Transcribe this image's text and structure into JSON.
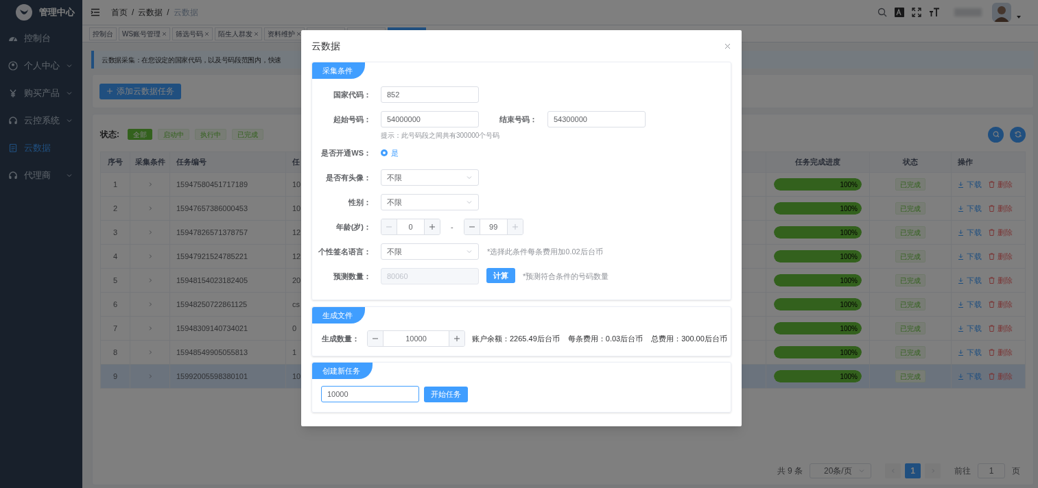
{
  "sidebar": {
    "title": "管理中心",
    "items": [
      {
        "label": "控制台",
        "kind": "dashboard",
        "has_children": false,
        "selected": false
      },
      {
        "label": "个人中心",
        "kind": "user",
        "has_children": true,
        "selected": false
      },
      {
        "label": "购买产品",
        "kind": "yen",
        "has_children": true,
        "selected": false
      },
      {
        "label": "云控系统",
        "kind": "cloud",
        "has_children": true,
        "selected": false
      },
      {
        "label": "云数据",
        "kind": "doc",
        "has_children": false,
        "selected": true
      },
      {
        "label": "代理商",
        "kind": "cloud",
        "has_children": true,
        "selected": false
      }
    ]
  },
  "header": {
    "breadcrumb": [
      {
        "label": "首页"
      },
      {
        "label": "云数据"
      },
      {
        "label": "云数据"
      }
    ],
    "separator": "/"
  },
  "tags": [
    {
      "label": "控制台",
      "closable": false,
      "selected": false
    },
    {
      "label": "WS账号管理",
      "closable": true,
      "selected": false
    },
    {
      "label": "筛选号码",
      "closable": true,
      "selected": false
    },
    {
      "label": "陌生人群发",
      "closable": true,
      "selected": false
    },
    {
      "label": "资料维护",
      "closable": true,
      "selected": false
    },
    {
      "selected": false
    },
    {
      "selected": false
    },
    {
      "selected": true
    }
  ],
  "alert": {
    "text": "云数据采集：在您设定的国家代码，以及号码段范围内，快速"
  },
  "add_button": "添加云数据任务",
  "filter": {
    "label": "状态:",
    "options": [
      {
        "label": "全部",
        "selected": true
      },
      {
        "label": "启动中",
        "selected": false
      },
      {
        "label": "执行中",
        "selected": false
      },
      {
        "label": "已完成",
        "selected": false
      }
    ]
  },
  "table": {
    "columns": [
      "序号",
      "采集条件",
      "任务编号",
      "任",
      "任务完成进度",
      "状态",
      "操作"
    ],
    "rows": [
      {
        "index": "1",
        "task_id": "15947580451717189",
        "column_4": "10",
        "level": 1,
        "progress": "100%",
        "status": "已完成",
        "download": "下载",
        "delete": "删除",
        "selected": false
      },
      {
        "index": "2",
        "task_id": "15947657386000453",
        "column_4": "10",
        "level": 1,
        "progress": "100%",
        "status": "已完成",
        "download": "下载",
        "delete": "删除",
        "selected": false
      },
      {
        "index": "3",
        "task_id": "15947826571378757",
        "column_4": "12",
        "level": 1,
        "progress": "100%",
        "status": "已完成",
        "download": "下载",
        "delete": "删除",
        "selected": false
      },
      {
        "index": "4",
        "task_id": "15947921524785221",
        "column_4": "12",
        "level": 1,
        "progress": "100%",
        "status": "已完成",
        "download": "下载",
        "delete": "删除",
        "selected": false
      },
      {
        "index": "5",
        "task_id": "15948154023182405",
        "column_4": "20",
        "level": 1,
        "progress": "100%",
        "status": "已完成",
        "download": "下载",
        "delete": "删除",
        "selected": false
      },
      {
        "index": "6",
        "task_id": "15948250722861125",
        "column_4": "cs",
        "level": 1,
        "progress": "100%",
        "status": "已完成",
        "download": "下载",
        "delete": "删除",
        "selected": false
      },
      {
        "index": "7",
        "task_id": "15948309140734021",
        "column_4": "0",
        "level": 1,
        "progress": "100%",
        "status": "已完成",
        "download": "下载",
        "delete": "删除",
        "selected": false
      },
      {
        "index": "8",
        "task_id": "15948549905055813",
        "column_4": "1",
        "level": 1,
        "progress": "100%",
        "status": "已完成",
        "download": "下载",
        "delete": "删除",
        "selected": false
      },
      {
        "index": "9",
        "task_id": "15992005598380101",
        "column_4": "10",
        "level": 1,
        "progress": "100%",
        "status": "已完成",
        "download": "下载",
        "delete": "删除",
        "selected": true
      }
    ]
  },
  "pagination": {
    "total": "共 9 条",
    "page_size": "20条/页",
    "pages": [
      {
        "label": "1",
        "selected": true
      }
    ],
    "goto_label": "前往",
    "goto_value": "1",
    "page_suffix": "页"
  },
  "modal": {
    "title": "云数据",
    "criteria": {
      "title": "采集条件",
      "fields": [
        {
          "kind": "input",
          "label": "国家代码：",
          "value": "852"
        },
        {
          "kind": "input_pair",
          "label": "起始号码：",
          "value": "54000000",
          "label_2": "结束号码：",
          "value_2": "54300000",
          "hint": "提示：此号码段之间共有300000个号码"
        },
        {
          "kind": "radio",
          "label": "是否开通WS：",
          "options": [
            {
              "label": "是",
              "selected": true
            }
          ]
        },
        {
          "kind": "select",
          "label": "是否有头像：",
          "value": "不限"
        },
        {
          "kind": "select",
          "label": "性别：",
          "value": "不限"
        },
        {
          "kind": "stepper_range",
          "label": "年龄(岁)：",
          "min": {
            "value": "0",
            "minus_disabled": true,
            "plus_disabled": false
          },
          "separator": "-",
          "max": {
            "value": "99",
            "minus_disabled": false,
            "plus_disabled": true
          }
        },
        {
          "kind": "select",
          "label": "个性签名语言：",
          "value": "不限",
          "note": "*选择此条件每条费用加0.02后台币"
        },
        {
          "kind": "predict",
          "label": "预测数量：",
          "value": "80060",
          "disabled": true,
          "button": "计算",
          "note": "*预测符合条件的号码数量"
        }
      ]
    },
    "generate": {
      "title": "生成文件",
      "label": "生成数量：",
      "stepper": {
        "value": "10000",
        "minus_disabled": false,
        "plus_disabled": false
      },
      "stats": [
        "账户余额：2265.49后台币",
        "每条费用：0.03后台币",
        "总费用：300.00后台币"
      ]
    },
    "create": {
      "title": "创建新任务",
      "input": {
        "value": "10000",
        "focused": true
      },
      "button": "开始任务"
    }
  }
}
